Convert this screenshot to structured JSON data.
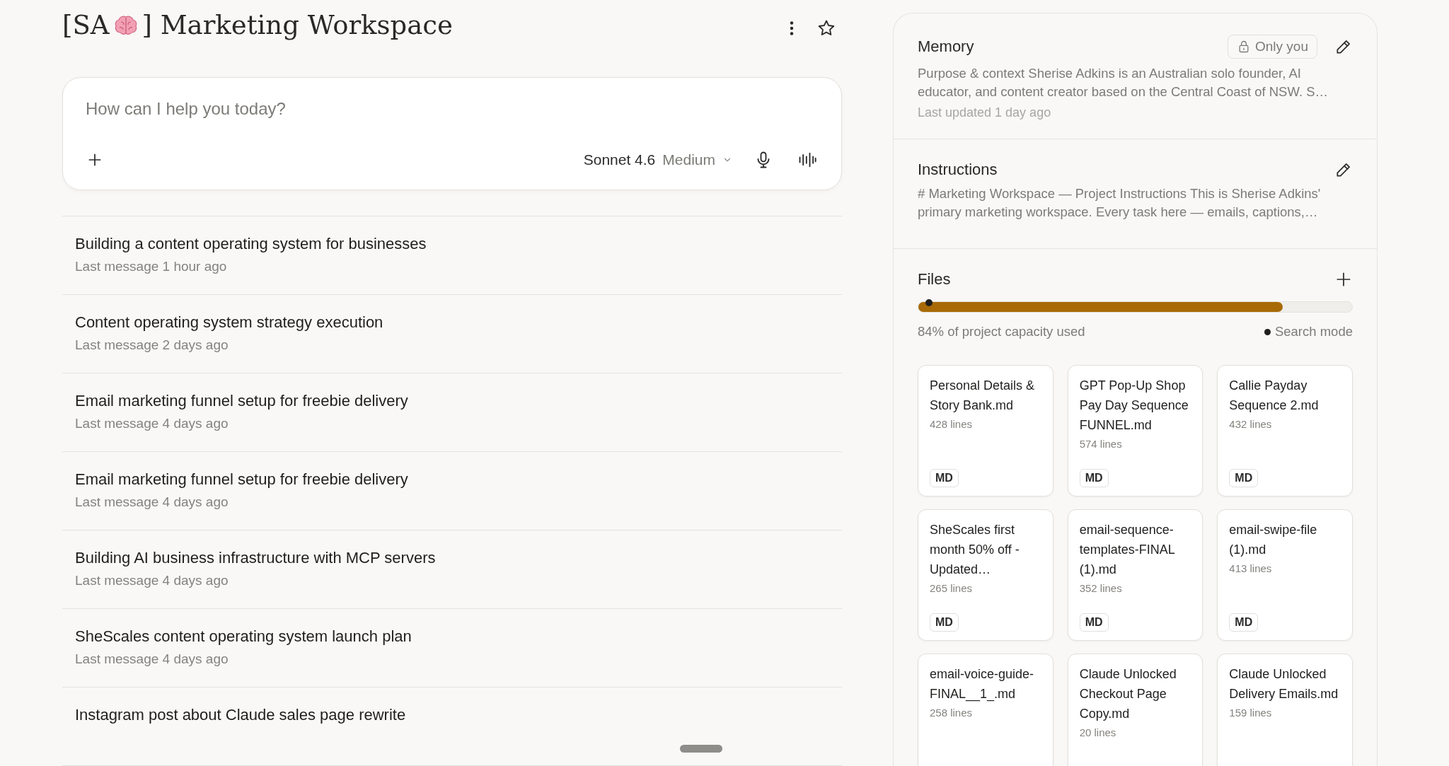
{
  "project": {
    "title_start": "[SA",
    "title_end": "] Marketing Workspace"
  },
  "composer": {
    "placeholder": "How can I help you today?",
    "model": "Sonnet 4.6",
    "effort": "Medium"
  },
  "conversations": [
    {
      "title": "Building a content operating system for businesses",
      "meta": "Last message 1 hour ago"
    },
    {
      "title": "Content operating system strategy execution",
      "meta": "Last message 2 days ago"
    },
    {
      "title": "Email marketing funnel setup for freebie delivery",
      "meta": "Last message 4 days ago"
    },
    {
      "title": "Email marketing funnel setup for freebie delivery",
      "meta": "Last message 4 days ago"
    },
    {
      "title": "Building AI business infrastructure with MCP servers",
      "meta": "Last message 4 days ago"
    },
    {
      "title": "SheScales content operating system launch plan",
      "meta": "Last message 4 days ago"
    },
    {
      "title": "Instagram post about Claude sales page rewrite"
    }
  ],
  "memory": {
    "title": "Memory",
    "visibility": "Only you",
    "text": "Purpose & context Sherise Adkins is an Australian solo founder, AI educator, and content creator based on the Central Coast of NSW. S…",
    "updated": "Last updated 1 day ago"
  },
  "instructions": {
    "title": "Instructions",
    "text": "# Marketing Workspace — Project Instructions This is Sherise Adkins' primary marketing workspace. Every task here — emails, captions,…"
  },
  "files": {
    "title": "Files",
    "capacity": {
      "level": 0.84,
      "label": "84% of project capacity used"
    },
    "mode": "Search mode",
    "items": [
      {
        "name": "Personal Details & Story Bank.md",
        "lines": "428 lines",
        "type": "MD"
      },
      {
        "name": "GPT Pop-Up Shop Pay Day Sequence FUNNEL.md",
        "lines": "574 lines",
        "type": "MD"
      },
      {
        "name": "Callie Payday Sequence 2.md",
        "lines": "432 lines",
        "type": "MD"
      },
      {
        "name": "SheScales first month 50% off - Updated…",
        "lines": "265 lines",
        "type": "MD"
      },
      {
        "name": "email-sequence-templates-FINAL (1).md",
        "lines": "352 lines",
        "type": "MD"
      },
      {
        "name": "email-swipe-file (1).md",
        "lines": "413 lines",
        "type": "MD"
      },
      {
        "name": "email-voice-guide-FINAL__1_.md",
        "lines": "258 lines"
      },
      {
        "name": "Claude Unlocked Checkout Page Copy.md",
        "lines": "20 lines"
      },
      {
        "name": "Claude Unlocked Delivery Emails.md",
        "lines": "159 lines"
      }
    ]
  }
}
